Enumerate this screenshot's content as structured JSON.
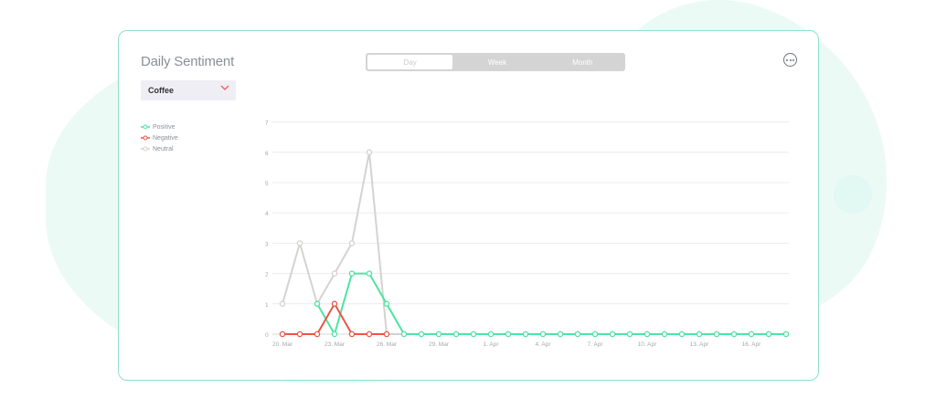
{
  "card": {
    "title": "Daily Sentiment",
    "more_icon": "more-horizontal-icon"
  },
  "period_toggle": {
    "options": [
      "Day",
      "Week",
      "Month"
    ],
    "selected": "Day"
  },
  "topic_select": {
    "value": "Coffee",
    "icon": "chevron-down-icon",
    "icon_color": "#ef5b4f"
  },
  "colors": {
    "positive": "#4fe3a3",
    "negative": "#eb5548",
    "neutral": "#d5d3d0",
    "accent_border": "#8fe0cb"
  },
  "chart_data": {
    "type": "line",
    "x": [
      "20. Mar",
      "21. Mar",
      "22. Mar",
      "23. Mar",
      "24. Mar",
      "25. Mar",
      "26. Mar",
      "27. Mar",
      "28. Mar",
      "29. Mar",
      "30. Mar",
      "31. Mar",
      "1. Apr",
      "2. Apr",
      "3. Apr",
      "4. Apr",
      "5. Apr",
      "6. Apr",
      "7. Apr",
      "8. Apr",
      "9. Apr",
      "10. Apr",
      "11. Apr",
      "12. Apr",
      "13. Apr",
      "14. Apr",
      "15. Apr",
      "16. Apr",
      "17. Apr",
      "18. Apr"
    ],
    "x_tick_labels": [
      "20. Mar",
      "23. Mar",
      "26. Mar",
      "29. Mar",
      "1. Apr",
      "4. Apr",
      "7. Apr",
      "10. Apr",
      "13. Apr",
      "16. Apr"
    ],
    "y_ticks": [
      0,
      1,
      2,
      3,
      4,
      5,
      6,
      7
    ],
    "ylim": [
      0,
      7
    ],
    "grid": true,
    "legend_position": "top-left",
    "series": [
      {
        "name": "Neutral",
        "color": "#d5d3d0",
        "values": [
          1,
          3,
          1,
          2,
          3,
          6,
          0,
          0,
          0,
          0,
          0,
          0,
          0,
          0,
          0,
          0,
          0,
          0,
          0,
          0,
          0,
          0,
          0,
          0,
          0,
          0,
          0,
          0,
          0,
          0
        ]
      },
      {
        "name": "Positive",
        "color": "#4fe3a3",
        "values": [
          null,
          null,
          1,
          0,
          2,
          2,
          1,
          0,
          0,
          0,
          0,
          0,
          0,
          0,
          0,
          0,
          0,
          0,
          0,
          0,
          0,
          0,
          0,
          0,
          0,
          0,
          0,
          0,
          0,
          0
        ]
      },
      {
        "name": "Negative",
        "color": "#eb5548",
        "values": [
          0,
          0,
          0,
          1,
          0,
          0,
          0,
          null,
          null,
          null,
          null,
          null,
          null,
          null,
          null,
          null,
          null,
          null,
          null,
          null,
          null,
          null,
          null,
          null,
          null,
          null,
          null,
          null,
          null,
          null
        ]
      }
    ]
  }
}
